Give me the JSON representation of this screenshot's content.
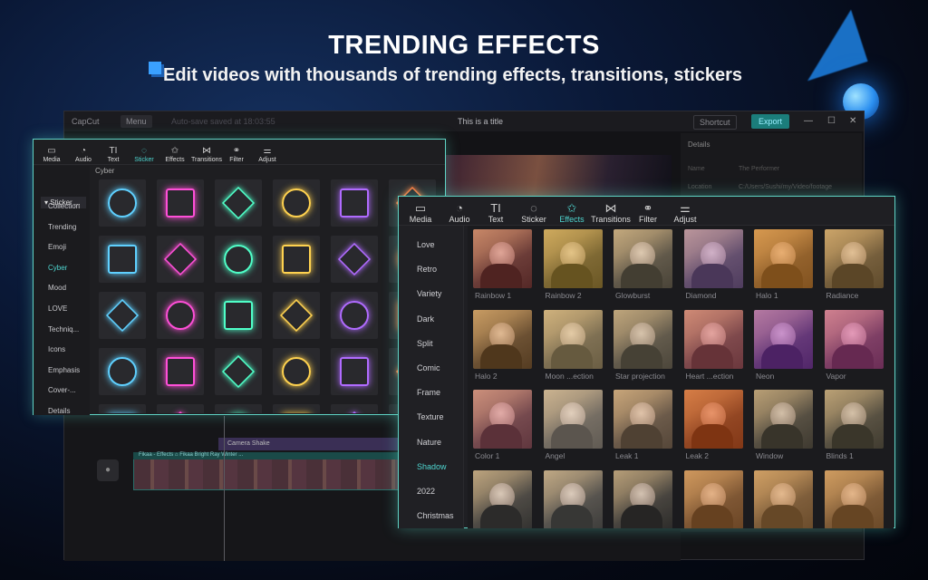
{
  "hero": {
    "title": "TRENDING EFFECTS",
    "subtitle": "Edit videos with thousands of trending effects, transitions, stickers"
  },
  "app": {
    "logo": "CapCut",
    "menu": "Menu",
    "autosave": "Auto-save saved at 18:03:55",
    "title": "This is a title",
    "shortcut": "Shortcut",
    "export": "Export",
    "win_min": "—",
    "win_max": "☐",
    "win_close": "✕"
  },
  "details": {
    "header": "Details",
    "rows": [
      {
        "k": "Name",
        "v": "The Performer"
      },
      {
        "k": "Location",
        "v": "C:/Users/Sushi/my/Video/footage"
      }
    ]
  },
  "timeline": {
    "track_label": "Camera Shake",
    "clip_label": "Fikaa - Effects   ⌂ Fikaa   Bright Ray   Winter ..."
  },
  "sticker_panel": {
    "tools": [
      {
        "label": "Media",
        "icon": "▭"
      },
      {
        "label": "Audio",
        "icon": "◔"
      },
      {
        "label": "Text",
        "icon": "TI"
      },
      {
        "label": "Sticker",
        "icon": "◌"
      },
      {
        "label": "Effects",
        "icon": "✩"
      },
      {
        "label": "Transitions",
        "icon": "⋈"
      },
      {
        "label": "Filter",
        "icon": "⚭"
      },
      {
        "label": "Adjust",
        "icon": "⚌"
      }
    ],
    "active_tool": "Sticker",
    "header": "▾ Sticker ...",
    "categories": [
      "Collection",
      "Trending",
      "Emoji",
      "Cyber",
      "Mood",
      "LOVE",
      "Techniq...",
      "Icons",
      "Emphasis",
      "Cover-...",
      "Details"
    ],
    "active_category": "Cyber",
    "section": "Cyber"
  },
  "effects_panel": {
    "tools": [
      {
        "label": "Media",
        "icon": "▭"
      },
      {
        "label": "Audio",
        "icon": "◔"
      },
      {
        "label": "Text",
        "icon": "TI"
      },
      {
        "label": "Sticker",
        "icon": "◌"
      },
      {
        "label": "Effects",
        "icon": "✩"
      },
      {
        "label": "Transitions",
        "icon": "⋈"
      },
      {
        "label": "Filter",
        "icon": "⚭"
      },
      {
        "label": "Adjust",
        "icon": "⚌"
      }
    ],
    "active_tool": "Effects",
    "categories": [
      "Love",
      "Retro",
      "Variety",
      "Dark",
      "Split",
      "Comic",
      "Frame",
      "Texture",
      "Nature",
      "Shadow",
      "2022",
      "Christmas"
    ],
    "active_category": "Shadow",
    "rows": [
      [
        "Rainbow 1",
        "Rainbow 2",
        "Glowburst",
        "Diamond",
        "Halo 1",
        "Radiance"
      ],
      [
        "Halo 2",
        "Moon ...ection",
        "Star projection",
        "Heart ...ection",
        "Neon",
        "Vapor"
      ],
      [
        "Color 1",
        "Angel",
        "Leak 1",
        "Leak 2",
        "Window",
        "Blinds 1"
      ],
      [
        "",
        "",
        "",
        "",
        "",
        ""
      ]
    ]
  },
  "colors": {
    "accent": "#4fd6d0",
    "border_glow": "#5fd3c4"
  }
}
